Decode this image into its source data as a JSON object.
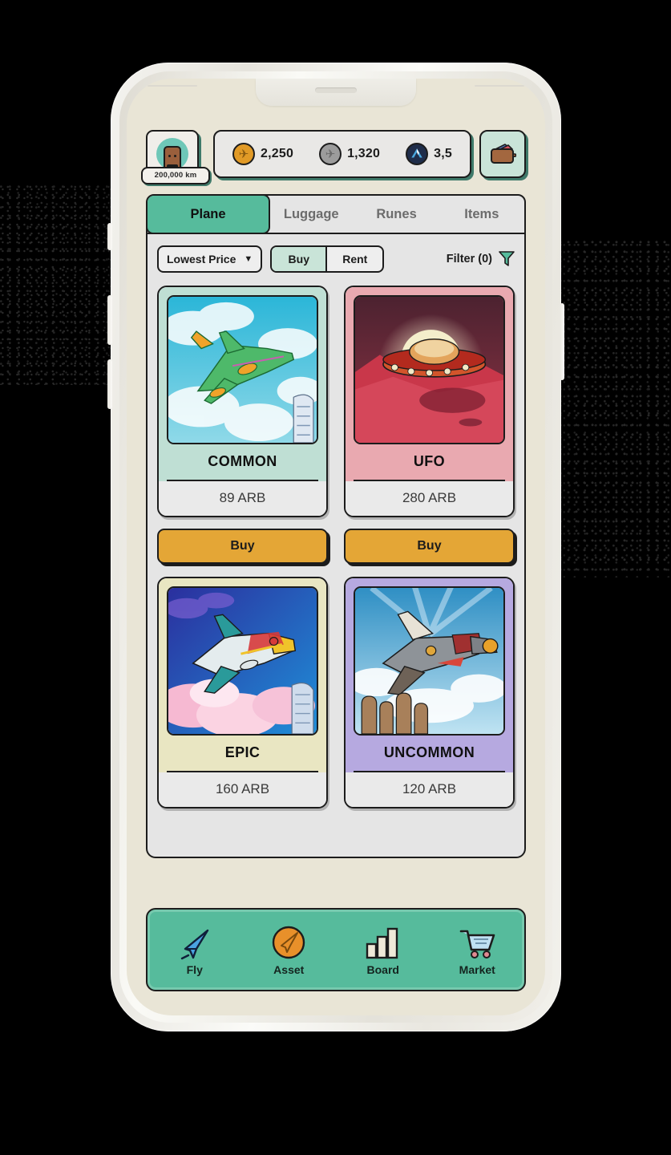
{
  "header": {
    "avatar_name": "player-avatar",
    "distance_badge": "200,000 km",
    "stats": [
      {
        "icon": "gold-plane-coin-icon",
        "value": "2,250"
      },
      {
        "icon": "silver-plane-coin-icon",
        "value": "1,320"
      },
      {
        "icon": "arbitrum-token-icon",
        "value": "3,5"
      }
    ],
    "wallet_icon": "wallet-icon"
  },
  "tabs": [
    {
      "label": "Plane",
      "active": true
    },
    {
      "label": "Luggage",
      "active": false
    },
    {
      "label": "Runes",
      "active": false
    },
    {
      "label": "Items",
      "active": false
    }
  ],
  "filter_bar": {
    "sort_value": "Lowest Price",
    "sort_chevron": "chevron-down-icon",
    "mode_options": [
      {
        "label": "Buy",
        "active": true
      },
      {
        "label": "Rent",
        "active": false
      }
    ],
    "filter_label": "Filter (0)",
    "filter_icon": "funnel-icon"
  },
  "cards": [
    {
      "rarity": "COMMON",
      "price": "89 ARB",
      "body_color": "#bfdfd4",
      "thumb": "green-passenger-plane-over-city",
      "action": "Buy"
    },
    {
      "rarity": "UFO",
      "price": "280 ARB",
      "body_color": "#e9a9b0",
      "thumb": "ufo-over-red-planet",
      "action": "Buy"
    },
    {
      "rarity": "EPIC",
      "price": "160 ARB",
      "body_color": "#e9e6c2",
      "thumb": "colorful-jumbo-jet-in-pink-clouds",
      "action": ""
    },
    {
      "rarity": "UNCOMMON",
      "price": "120 ARB",
      "body_color": "#b6a9e0",
      "thumb": "military-jet-over-moai-statues",
      "action": ""
    }
  ],
  "bottom_nav": [
    {
      "label": "Fly",
      "icon": "paper-plane-icon"
    },
    {
      "label": "Asset",
      "icon": "gold-coin-plane-icon"
    },
    {
      "label": "Board",
      "icon": "bar-chart-icon"
    },
    {
      "label": "Market",
      "icon": "shopping-cart-icon"
    }
  ],
  "colors": {
    "accent_green": "#56bb9c",
    "buy_orange": "#e4a636",
    "screen_bg": "#e9e5d6",
    "panel_bg": "#e5e5e5",
    "outline": "#1c1c1c"
  }
}
